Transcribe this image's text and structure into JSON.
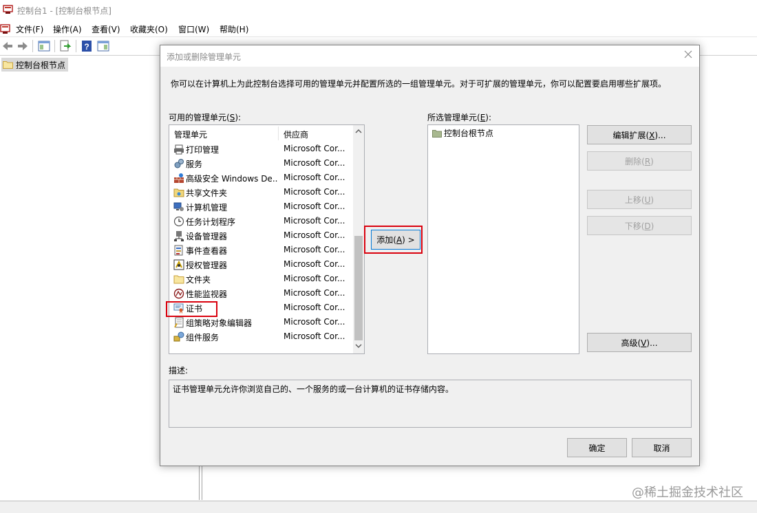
{
  "window": {
    "title": "控制台1 - [控制台根节点]",
    "menu": [
      "文件(F)",
      "操作(A)",
      "查看(V)",
      "收藏夹(O)",
      "窗口(W)",
      "帮助(H)"
    ],
    "toolbar_icons": [
      "back-icon",
      "forward-icon",
      "show-hide-tree-icon",
      "export-list-icon",
      "help-icon",
      "show-hide-action-pane-icon"
    ],
    "tree_root": "控制台根节点"
  },
  "dialog": {
    "title": "添加或删除管理单元",
    "intro": "你可以在计算机上为此控制台选择可用的管理单元并配置所选的一组管理单元。对于可扩展的管理单元，你可以配置要启用哪些扩展项。",
    "available_label": "可用的管理单元(",
    "available_label_key": "S",
    "available_label_end": "):",
    "columns": [
      "管理单元",
      "供应商"
    ],
    "snapins": [
      {
        "name": "打印管理",
        "vendor": "Microsoft Cor...",
        "icon": "printer-icon"
      },
      {
        "name": "服务",
        "vendor": "Microsoft Cor...",
        "icon": "gears-icon"
      },
      {
        "name": "高级安全 Windows De...",
        "vendor": "Microsoft Cor...",
        "icon": "firewall-icon"
      },
      {
        "name": "共享文件夹",
        "vendor": "Microsoft Cor...",
        "icon": "shared-folder-icon"
      },
      {
        "name": "计算机管理",
        "vendor": "Microsoft Cor...",
        "icon": "computer-management-icon"
      },
      {
        "name": "任务计划程序",
        "vendor": "Microsoft Cor...",
        "icon": "clock-icon"
      },
      {
        "name": "设备管理器",
        "vendor": "Microsoft Cor...",
        "icon": "device-manager-icon"
      },
      {
        "name": "事件查看器",
        "vendor": "Microsoft Cor...",
        "icon": "event-viewer-icon"
      },
      {
        "name": "授权管理器",
        "vendor": "Microsoft Cor...",
        "icon": "authorization-icon"
      },
      {
        "name": "文件夹",
        "vendor": "Microsoft Cor...",
        "icon": "folder-icon"
      },
      {
        "name": "性能监视器",
        "vendor": "Microsoft Cor...",
        "icon": "performance-monitor-icon"
      },
      {
        "name": "证书",
        "vendor": "Microsoft Cor...",
        "icon": "certificate-icon"
      },
      {
        "name": "组策略对象编辑器",
        "vendor": "Microsoft Cor...",
        "icon": "group-policy-icon"
      },
      {
        "name": "组件服务",
        "vendor": "Microsoft Cor...",
        "icon": "component-services-icon"
      }
    ],
    "add_button": {
      "label": "添加(",
      "key": "A",
      "end": ") >"
    },
    "selected_label": "所选管理单元(",
    "selected_label_key": "E",
    "selected_label_end": "):",
    "selected_items": [
      "控制台根节点"
    ],
    "buttons": {
      "edit_ext": {
        "label": "编辑扩展(",
        "key": "X",
        "end": ")..."
      },
      "remove": {
        "label": "删除(",
        "key": "R",
        "end": ")"
      },
      "move_up": {
        "label": "上移(",
        "key": "U",
        "end": ")"
      },
      "move_down": {
        "label": "下移(",
        "key": "D",
        "end": ")"
      },
      "advanced": {
        "label": "高级(",
        "key": "V",
        "end": ")..."
      },
      "ok": "确定",
      "cancel": "取消"
    },
    "desc_label": "描述:",
    "description": "证书管理单元允许你浏览自己的、一个服务的或一台计算机的证书存储内容。"
  },
  "watermark": "@稀土掘金技术社区",
  "colors": {
    "highlight_box": "#d9000d",
    "dialog_bg": "#f0f0f0",
    "list_bg": "#ffffff"
  }
}
